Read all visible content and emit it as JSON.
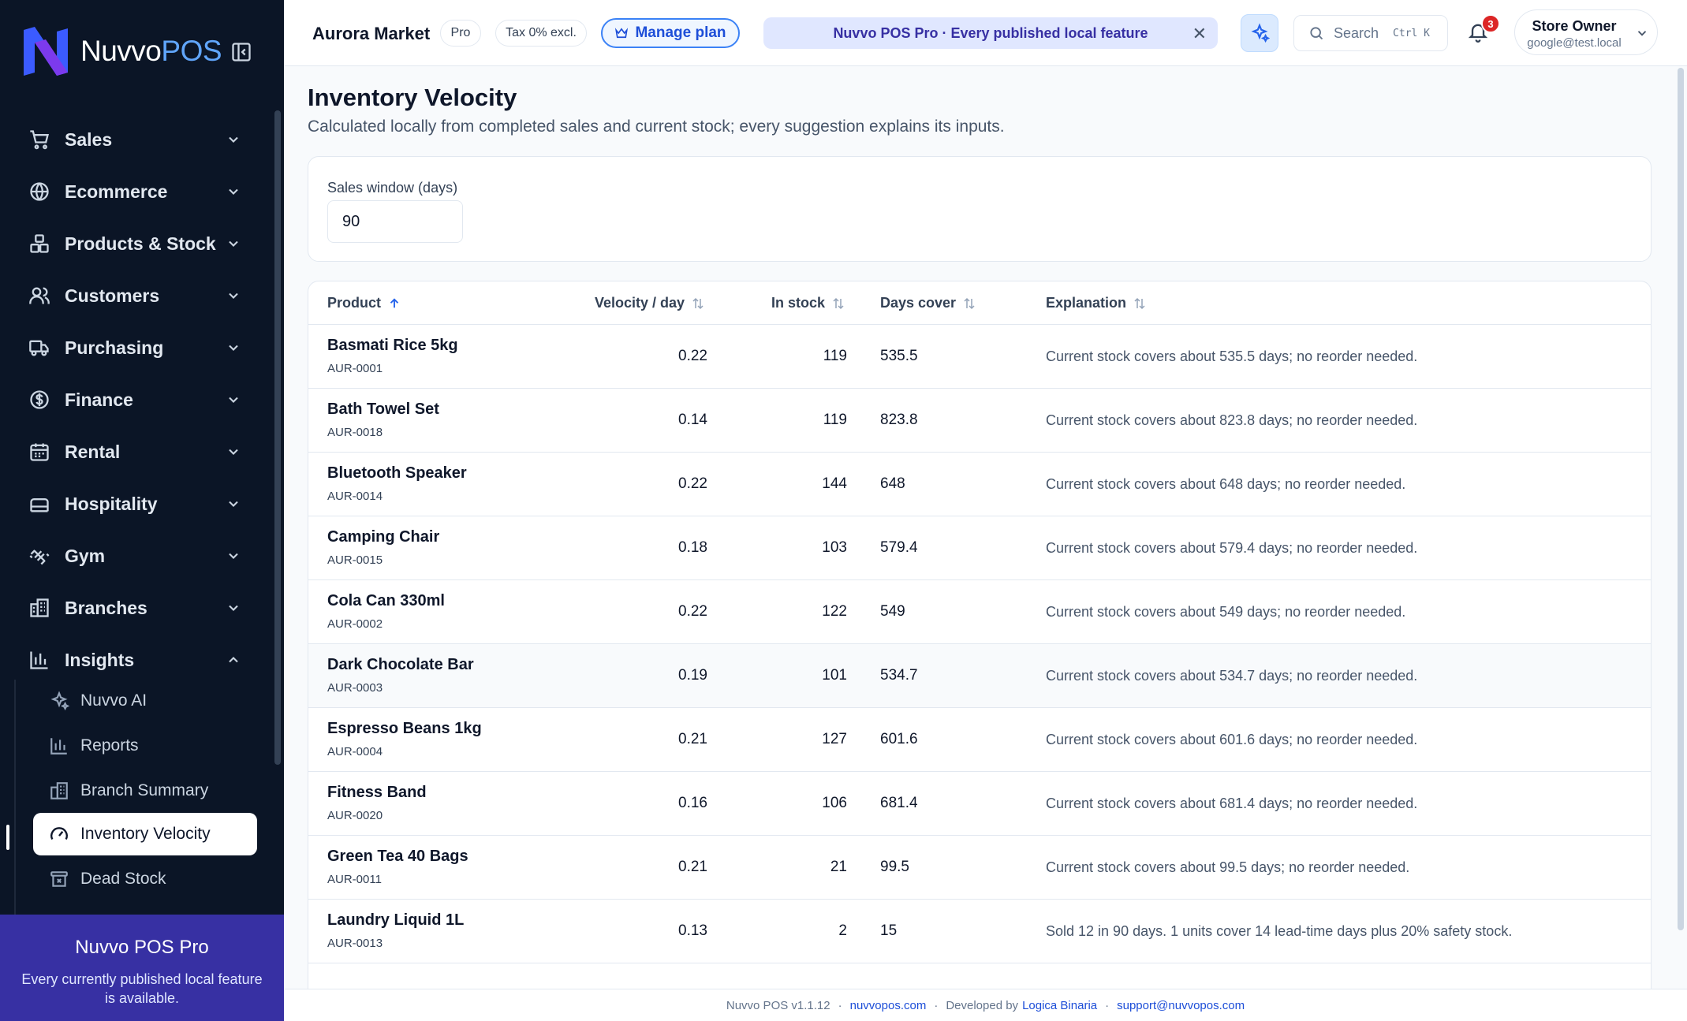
{
  "brand": {
    "name_part1": "Nuvvo",
    "name_part2": "POS"
  },
  "sidebar": {
    "items": [
      {
        "label": "Sales"
      },
      {
        "label": "Ecommerce"
      },
      {
        "label": "Products & Stock"
      },
      {
        "label": "Customers"
      },
      {
        "label": "Purchasing"
      },
      {
        "label": "Finance"
      },
      {
        "label": "Rental"
      },
      {
        "label": "Hospitality"
      },
      {
        "label": "Gym"
      },
      {
        "label": "Branches"
      },
      {
        "label": "Insights"
      }
    ],
    "insights_sub": [
      {
        "label": "Nuvvo AI"
      },
      {
        "label": "Reports"
      },
      {
        "label": "Branch Summary"
      },
      {
        "label": "Inventory Velocity"
      },
      {
        "label": "Dead Stock"
      }
    ],
    "promo": {
      "title": "Nuvvo POS Pro",
      "text": "Every currently published local feature is available."
    }
  },
  "topbar": {
    "store_name": "Aurora Market",
    "plan_badge": "Pro",
    "tax_badge": "Tax 0% excl.",
    "manage_plan": "Manage plan",
    "banner": "Nuvvo POS Pro · Every published local feature",
    "search_placeholder": "Search",
    "search_shortcut": "Ctrl K",
    "notifications_count": "3",
    "user_name": "Store Owner",
    "user_email": "google@test.local"
  },
  "page": {
    "title": "Inventory Velocity",
    "subtitle": "Calculated locally from completed sales and current stock; every suggestion explains its inputs.",
    "sales_window_label": "Sales window (days)",
    "sales_window_value": "90"
  },
  "table": {
    "headers": {
      "product": "Product",
      "velocity": "Velocity / day",
      "stock": "In stock",
      "cover": "Days cover",
      "explanation": "Explanation"
    },
    "rows": [
      {
        "name": "Basmati Rice 5kg",
        "sku": "AUR-0001",
        "velocity": "0.22",
        "stock": "119",
        "cover": "535.5",
        "explanation": "Current stock covers about 535.5 days; no reorder needed."
      },
      {
        "name": "Bath Towel Set",
        "sku": "AUR-0018",
        "velocity": "0.14",
        "stock": "119",
        "cover": "823.8",
        "explanation": "Current stock covers about 823.8 days; no reorder needed."
      },
      {
        "name": "Bluetooth Speaker",
        "sku": "AUR-0014",
        "velocity": "0.22",
        "stock": "144",
        "cover": "648",
        "explanation": "Current stock covers about 648 days; no reorder needed."
      },
      {
        "name": "Camping Chair",
        "sku": "AUR-0015",
        "velocity": "0.18",
        "stock": "103",
        "cover": "579.4",
        "explanation": "Current stock covers about 579.4 days; no reorder needed."
      },
      {
        "name": "Cola Can 330ml",
        "sku": "AUR-0002",
        "velocity": "0.22",
        "stock": "122",
        "cover": "549",
        "explanation": "Current stock covers about 549 days; no reorder needed."
      },
      {
        "name": "Dark Chocolate Bar",
        "sku": "AUR-0003",
        "velocity": "0.19",
        "stock": "101",
        "cover": "534.7",
        "explanation": "Current stock covers about 534.7 days; no reorder needed."
      },
      {
        "name": "Espresso Beans 1kg",
        "sku": "AUR-0004",
        "velocity": "0.21",
        "stock": "127",
        "cover": "601.6",
        "explanation": "Current stock covers about 601.6 days; no reorder needed."
      },
      {
        "name": "Fitness Band",
        "sku": "AUR-0020",
        "velocity": "0.16",
        "stock": "106",
        "cover": "681.4",
        "explanation": "Current stock covers about 681.4 days; no reorder needed."
      },
      {
        "name": "Green Tea 40 Bags",
        "sku": "AUR-0011",
        "velocity": "0.21",
        "stock": "21",
        "cover": "99.5",
        "explanation": "Current stock covers about 99.5 days; no reorder needed."
      },
      {
        "name": "Laundry Liquid 1L",
        "sku": "AUR-0013",
        "velocity": "0.13",
        "stock": "2",
        "cover": "15",
        "explanation": "Sold 12 in 90 days. 1 units cover 14 lead-time days plus 20% safety stock."
      }
    ]
  },
  "footer": {
    "version": "Nuvvo POS v1.1.12",
    "site": "nuvvopos.com",
    "developed_by": "Developed by",
    "company": "Logica Binaria",
    "email": "support@nuvvopos.com",
    "separator": "·"
  }
}
